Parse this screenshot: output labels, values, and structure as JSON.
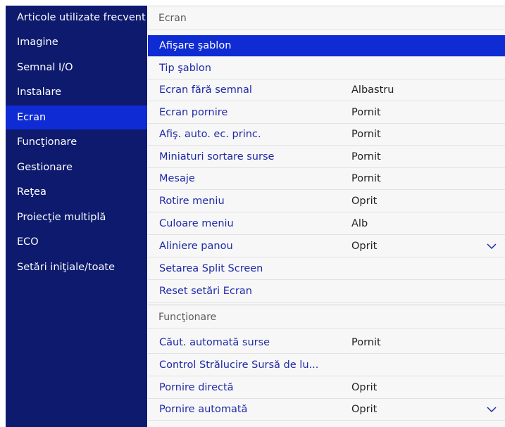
{
  "colors": {
    "sidebar_bg": "#0d1a6e",
    "highlight": "#0f2bd4",
    "item_text": "#1f2aa6",
    "panel_bg": "#f7f7f7"
  },
  "sidebar": {
    "selected_index": 4,
    "items": [
      {
        "label": "Articole utilizate frecvent"
      },
      {
        "label": "Imagine"
      },
      {
        "label": "Semnal I/O"
      },
      {
        "label": "Instalare"
      },
      {
        "label": "Ecran"
      },
      {
        "label": "Funcţionare"
      },
      {
        "label": "Gestionare"
      },
      {
        "label": "Reţea"
      },
      {
        "label": "Proiecţie multiplă"
      },
      {
        "label": "ECO"
      },
      {
        "label": "Setări iniţiale/toate"
      }
    ]
  },
  "main": {
    "section1": {
      "header": "Ecran",
      "items": [
        {
          "label": "Afişare şablon",
          "value": ""
        },
        {
          "label": "Tip şablon",
          "value": ""
        },
        {
          "label": "Ecran fără semnal",
          "value": "Albastru"
        },
        {
          "label": "Ecran pornire",
          "value": "Pornit"
        },
        {
          "label": "Afiş. auto. ec. princ.",
          "value": "Pornit"
        },
        {
          "label": "Miniaturi sortare surse",
          "value": "Pornit"
        },
        {
          "label": "Mesaje",
          "value": "Pornit"
        },
        {
          "label": "Rotire meniu",
          "value": "Oprit"
        },
        {
          "label": "Culoare meniu",
          "value": "Alb"
        },
        {
          "label": "Aliniere panou",
          "value": "Oprit",
          "icon": "chevron-down-icon"
        },
        {
          "label": "Setarea Split Screen",
          "value": ""
        },
        {
          "label": "Reset setări Ecran",
          "value": ""
        }
      ]
    },
    "section2": {
      "header": "Funcţionare",
      "items": [
        {
          "label": "Căut. automată surse",
          "value": "Pornit"
        },
        {
          "label": "Control Strălucire Sursă de lu...",
          "value": ""
        },
        {
          "label": "Pornire directă",
          "value": "Oprit"
        },
        {
          "label": "Pornire automată",
          "value": "Oprit",
          "icon": "chevron-down-icon"
        }
      ]
    }
  }
}
